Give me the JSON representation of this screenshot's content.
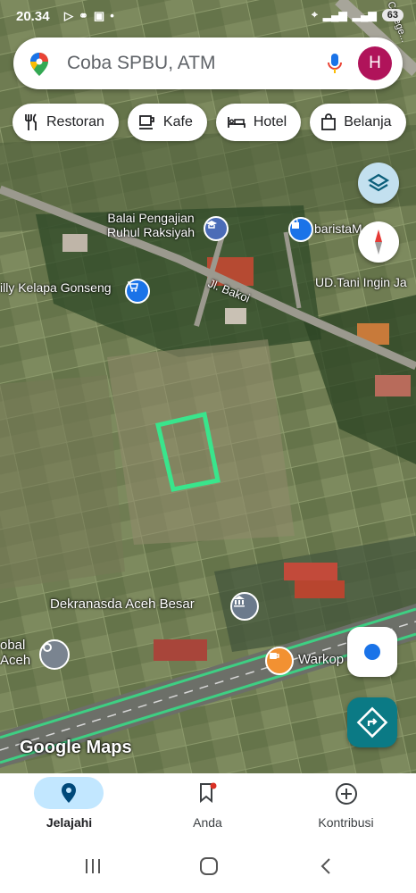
{
  "status_bar": {
    "time": "20.34",
    "left_icons": [
      "cast-icon",
      "usb-icon",
      "shop-icon",
      "dot-icon"
    ],
    "right_icons": [
      "location-icon",
      "signal-icon",
      "4g-icon",
      "signal-icon"
    ],
    "battery": "63"
  },
  "search": {
    "placeholder": "Coba SPBU, ATM",
    "avatar_letter": "H",
    "avatar_color": "#b0135a"
  },
  "chips": [
    {
      "icon": "restaurant-icon",
      "label": "Restoran"
    },
    {
      "icon": "cafe-icon",
      "label": "Kafe"
    },
    {
      "icon": "hotel-icon",
      "label": "Hotel"
    },
    {
      "icon": "shopping-icon",
      "label": "Belanja"
    }
  ],
  "map": {
    "places": [
      {
        "name": "Balai Pengajian\nRuhul Raksiyah",
        "icon": "school-icon"
      },
      {
        "name": "baristaM",
        "icon": "shopping-icon"
      },
      {
        "name": "illy Kelapa Gonseng",
        "icon": "shopping-cart-icon"
      },
      {
        "name": "Jl. Bakoi"
      },
      {
        "name": "UD.Tani Ingin Ja"
      },
      {
        "name": "Dekranasda Aceh Besar",
        "icon": "museum-icon"
      },
      {
        "name": "Warkop Ujong G",
        "icon": "coffee-icon"
      },
      {
        "name": "obal\nAceh"
      }
    ],
    "road_label_top": "Jl. Conege...",
    "attribution": "Google Maps"
  },
  "bottom_nav": [
    {
      "label": "Jelajahi",
      "icon": "location-pin-icon",
      "active": true
    },
    {
      "label": "Anda",
      "icon": "bookmark-icon",
      "active": false
    },
    {
      "label": "Kontribusi",
      "icon": "add-circle-icon",
      "active": false
    }
  ],
  "colors": {
    "accent_blue": "#1a73e8",
    "directions_fab": "#0b7a85",
    "selection_green": "#39e58c",
    "active_pill": "#c2e7ff"
  }
}
